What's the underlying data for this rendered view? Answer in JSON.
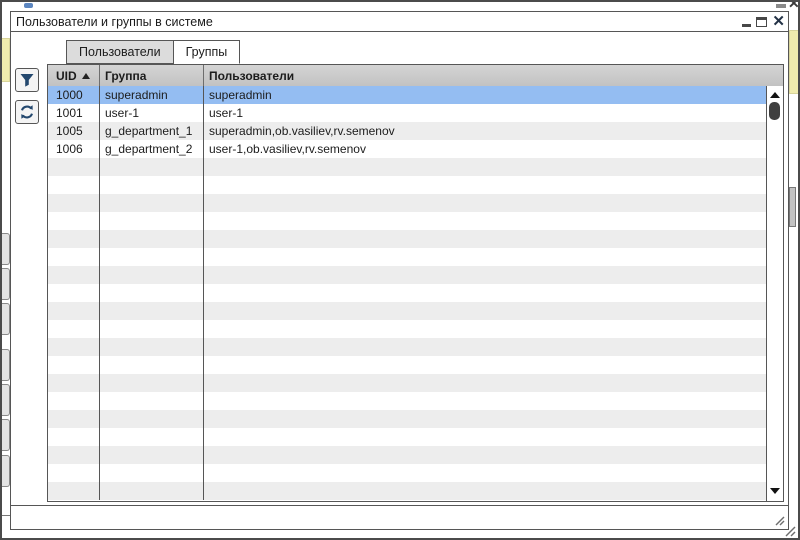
{
  "dialog": {
    "title": "Пользователи и группы в системе"
  },
  "tabs": [
    {
      "label": "Пользователи",
      "active": false
    },
    {
      "label": "Группы",
      "active": true
    }
  ],
  "toolbar": {
    "filter_icon": "filter-funnel",
    "refresh_icon": "refresh-arrows"
  },
  "table": {
    "columns": [
      "UID",
      "Группа",
      "Пользователи"
    ],
    "sort": {
      "column": "UID",
      "direction": "asc"
    },
    "selected_row_index": 0,
    "rows": [
      [
        "1000",
        "superadmin",
        "superadmin"
      ],
      [
        "1001",
        "user-1",
        "user-1"
      ],
      [
        "1005",
        "g_department_1",
        "superadmin,ob.vasiliev,rv.semenov"
      ],
      [
        "1006",
        "g_department_2",
        "user-1,ob.vasiliev,rv.semenov"
      ]
    ]
  },
  "colors": {
    "selection": "#94bdf2",
    "stripe": "#ededed",
    "header_bg": "#c9c9c9",
    "icon_accent": "#24486e",
    "side_panel_yellow": "#f0ecae"
  }
}
